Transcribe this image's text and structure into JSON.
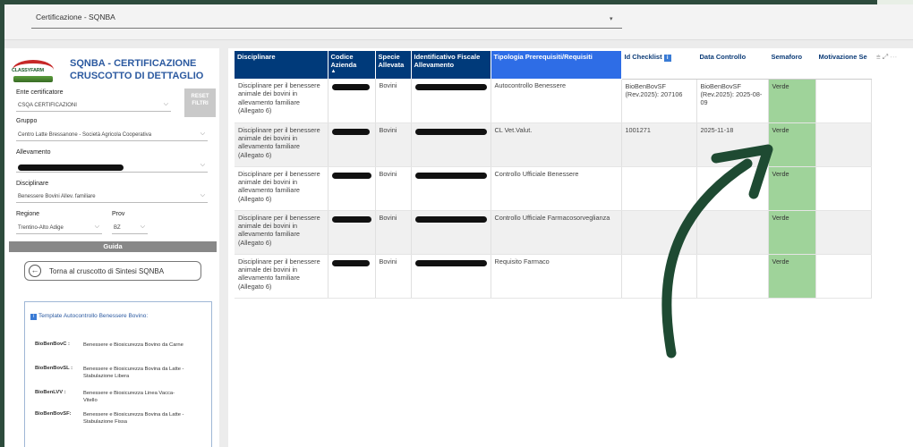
{
  "topbar": {
    "title": "Certificazione - SQNBA"
  },
  "left": {
    "logo_text": "CLASSYFARM",
    "title_line1": "SQNBA - CERTIFICAZIONE",
    "title_line2": "CRUSCOTTO DI DETTAGLIO",
    "reset_label": "RESET FILTRI",
    "filters": {
      "ente_label": "Ente certificatore",
      "ente_value": "CSQA CERTIFICAZIONI",
      "gruppo_label": "Gruppo",
      "gruppo_value": "Centro Latte Bressanone - Società Agricola Cooperativa",
      "allevamento_label": "Allevamento",
      "disciplinare_label": "Disciplinare",
      "disciplinare_value": "Benessere Bovini Allev. familiare",
      "regione_label": "Regione",
      "regione_value": "Trentino-Alto Adige",
      "prov_label": "Prov",
      "prov_value": "BZ"
    },
    "guida_label": "Guida",
    "back_label": "Torna al cruscotto di Sintesi SQNBA",
    "template": {
      "heading": "Template Autocontrollo Benessere Bovino:",
      "items": [
        {
          "key": "BioBenBovC :",
          "value": "Benessere e Biosicurezza Bovino da Carne"
        },
        {
          "key": "BioBenBovSL :",
          "value": "Benessere e Biosicurezza Bovina da Latte - Stabulazione Libera"
        },
        {
          "key": "BioBenLVV :",
          "value": "Benessere e Biosicurezza Linea Vacca-Vitello"
        },
        {
          "key": "BioBenBovSF:",
          "value": "Benessere e Biosicurezza Bovina da Latte - Stabulazione Fissa"
        }
      ]
    }
  },
  "table": {
    "headers": {
      "disciplinare": "Disciplinare",
      "codice": "Codice Azienda",
      "specie": "Specie Allevata",
      "idfisc": "Identificativo Fiscale Allevamento",
      "tipologia": "Tipologia Prerequisiti/Requisiti",
      "idchecklist": "Id Checklist",
      "data": "Data Controllo",
      "semaforo": "Semaforo",
      "motivazione": "Motivazione Se"
    },
    "rows": [
      {
        "disciplinare": "Disciplinare per il benessere animale dei bovini in allevamento familiare (Allegato 6)",
        "specie": "Bovini",
        "tipologia": "Autocontrollo Benessere",
        "idchecklist": "BioBenBovSF (Rev.2025): 207106",
        "data": "BioBenBovSF (Rev.2025): 2025-08-09",
        "semaforo": "Verde"
      },
      {
        "disciplinare": "Disciplinare per il benessere animale dei bovini in allevamento familiare (Allegato 6)",
        "specie": "Bovini",
        "tipologia": "CL Vet.Valut.",
        "idchecklist": "1001271",
        "data": "2025-11-18",
        "semaforo": "Verde"
      },
      {
        "disciplinare": "Disciplinare per il benessere animale dei bovini in allevamento familiare (Allegato 6)",
        "specie": "Bovini",
        "tipologia": "Controllo Ufficiale Benessere",
        "idchecklist": "",
        "data": "",
        "semaforo": "Verde"
      },
      {
        "disciplinare": "Disciplinare per il benessere animale dei bovini in allevamento familiare (Allegato 6)",
        "specie": "Bovini",
        "tipologia": "Controllo Ufficiale Farmacosorveglianza",
        "idchecklist": "",
        "data": "",
        "semaforo": "Verde"
      },
      {
        "disciplinare": "Disciplinare per il benessere animale dei bovini in allevamento familiare (Allegato 6)",
        "specie": "Bovini",
        "tipologia": "Requisito Farmaco",
        "idchecklist": "",
        "data": "",
        "semaforo": "Verde"
      }
    ]
  },
  "colors": {
    "header": "#003a7a",
    "header_highlight": "#2e6de6",
    "semaforo_green": "#9fd39a",
    "frame": "#2d4b3c"
  },
  "icons": [
    "back-circle-icon",
    "info-icon",
    "filter-icon",
    "expand-icon",
    "more-icon",
    "sort-icon",
    "chevron-down-icon"
  ]
}
